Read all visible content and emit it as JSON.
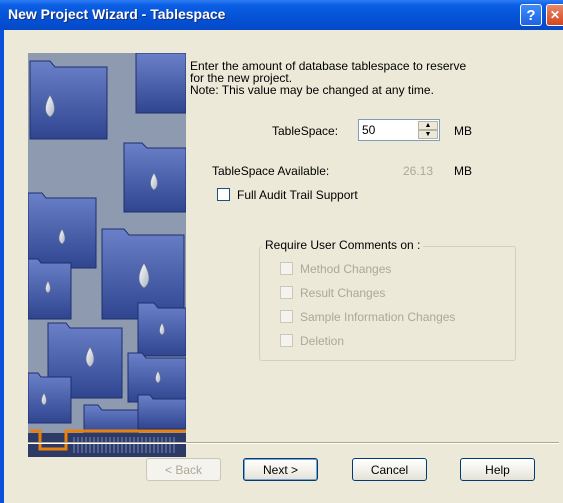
{
  "window": {
    "title": "New Project Wizard - Tablespace",
    "help_glyph": "?",
    "close_glyph": "✕"
  },
  "intro": {
    "line1": "Enter the amount of database tablespace to reserve",
    "line2": "for the new project.",
    "line3": "Note: This value may be changed at any time."
  },
  "tablespace": {
    "label": "TableSpace:",
    "value": "50",
    "unit": "MB",
    "up_glyph": "▲",
    "down_glyph": "▼"
  },
  "available": {
    "label": "TableSpace Available:",
    "value": "26.13",
    "unit": "MB"
  },
  "audit": {
    "label": "Full Audit Trail Support",
    "checked": false
  },
  "comments_group": {
    "title": "Require User Comments on :",
    "options": [
      {
        "label": "Method Changes",
        "checked": false,
        "enabled": false
      },
      {
        "label": "Result Changes",
        "checked": false,
        "enabled": false
      },
      {
        "label": "Sample Information Changes",
        "checked": false,
        "enabled": false
      },
      {
        "label": "Deletion",
        "checked": false,
        "enabled": false
      }
    ]
  },
  "buttons": {
    "back": "< Back",
    "next": "Next >",
    "cancel": "Cancel",
    "help": "Help"
  },
  "colors": {
    "titlebar": "#0553d6",
    "dialog_bg": "#ece9d8",
    "disabled_text": "#aca899",
    "art_accent": "#e8820c"
  }
}
